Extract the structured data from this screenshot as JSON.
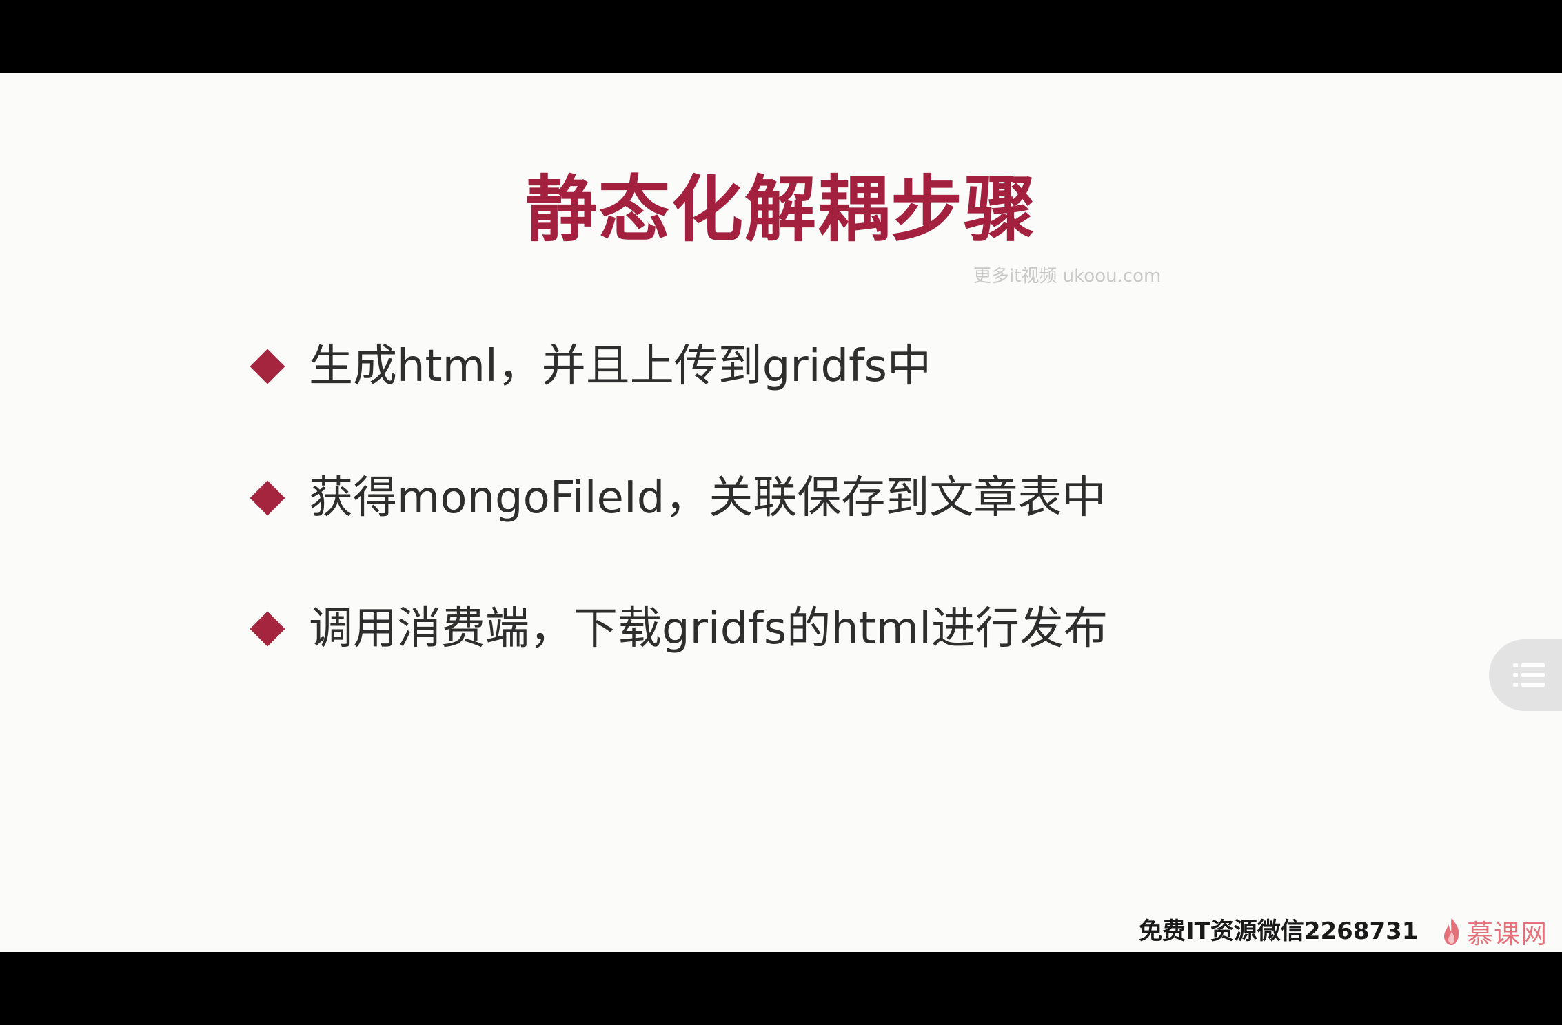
{
  "slide": {
    "title": "静态化解耦步骤",
    "bullets": [
      "生成html，并且上传到gridfs中",
      "获得mongoFileId，关联保存到文章表中",
      "调用消费端，下载gridfs的html进行发布"
    ]
  },
  "overlay": {
    "watermark": "更多it视频 ukoou.com",
    "footer_note": "免费IT资源微信2268731",
    "brand": "慕课网",
    "menu_icon": "list-menu-icon"
  },
  "colors": {
    "accent": "#a3213f",
    "text": "#2e2e2e",
    "background": "#fbfbfa",
    "brand": "#e4707a"
  }
}
